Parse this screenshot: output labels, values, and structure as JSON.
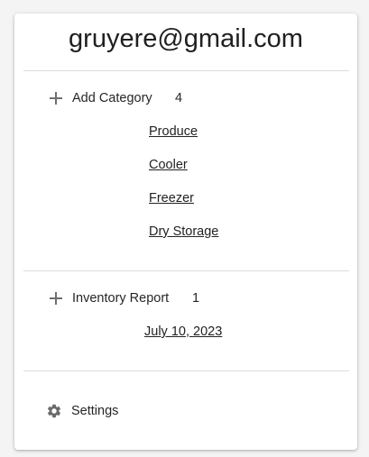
{
  "account": {
    "email": "gruyere@gmail.com"
  },
  "categories_section": {
    "add_label": "Add Category",
    "count": "4",
    "items": [
      "Produce",
      "Cooler",
      "Freezer",
      "Dry Storage"
    ]
  },
  "inventory_section": {
    "report_label": "Inventory Report",
    "count": "1",
    "items": [
      "July 10, 2023"
    ]
  },
  "settings": {
    "label": "Settings"
  },
  "icons": {
    "add": "plus-icon",
    "settings": "gear-icon"
  }
}
